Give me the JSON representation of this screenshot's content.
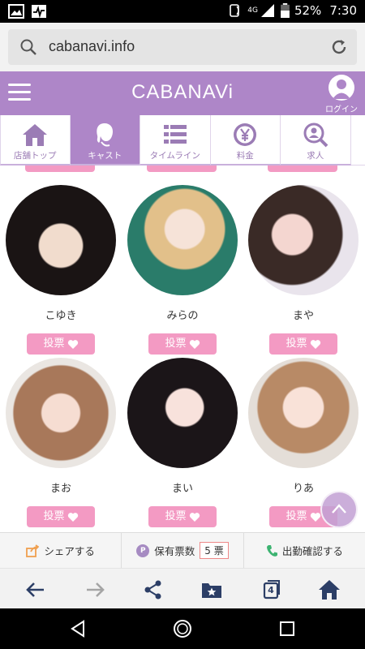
{
  "status": {
    "network": "4G",
    "battery": "52%",
    "time": "7:30"
  },
  "browser": {
    "url": "cabanavi.info",
    "tab_count": "4"
  },
  "header": {
    "logo": "CABANAVi",
    "login_label": "ログイン"
  },
  "tabs": [
    {
      "label": "店舗トップ",
      "icon": "home-icon",
      "active": false
    },
    {
      "label": "キャスト",
      "icon": "cast-icon",
      "active": true
    },
    {
      "label": "タイムライン",
      "icon": "list-icon",
      "active": false
    },
    {
      "label": "料金",
      "icon": "yen-icon",
      "active": false
    },
    {
      "label": "求人",
      "icon": "search-person-icon",
      "active": false
    }
  ],
  "cast": [
    {
      "name": "こゆき",
      "vote_label": "投票"
    },
    {
      "name": "みらの",
      "vote_label": "投票"
    },
    {
      "name": "まや",
      "vote_label": "投票"
    },
    {
      "name": "まお",
      "vote_label": "投票"
    },
    {
      "name": "まい",
      "vote_label": "投票"
    },
    {
      "name": "りあ",
      "vote_label": "投票"
    }
  ],
  "bottom_bar": {
    "share_label": "シェアする",
    "votes_label": "保有票数",
    "votes_count": "5 票",
    "attendance_label": "出勤確認する"
  },
  "colors": {
    "brand": "#ae86c8",
    "vote": "#f39ac3"
  }
}
